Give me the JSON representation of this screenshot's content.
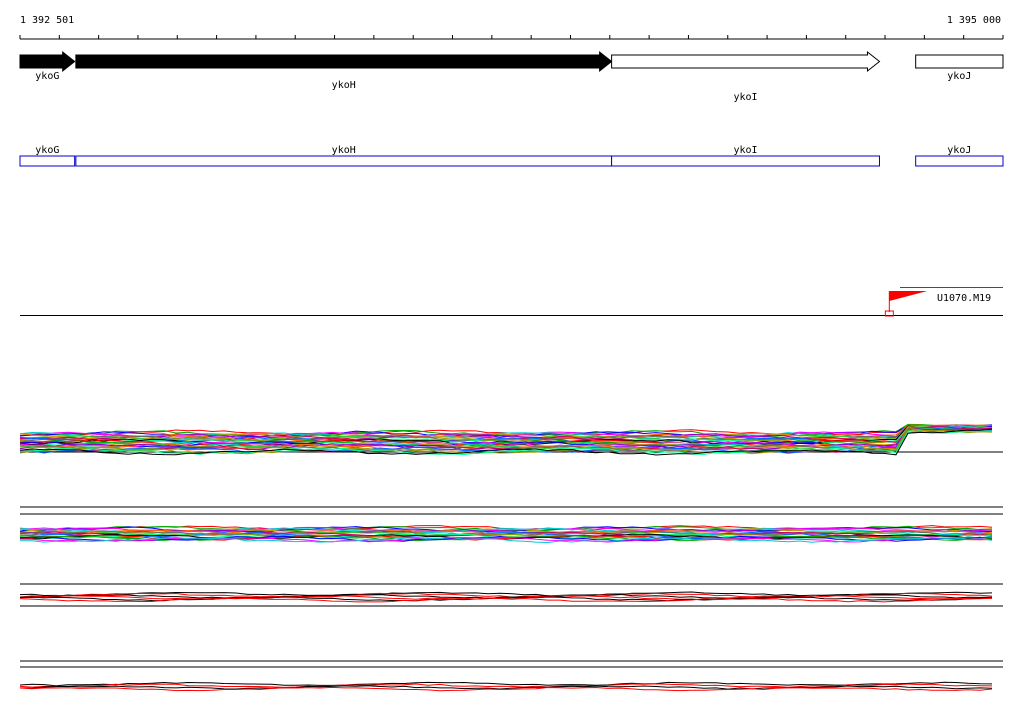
{
  "ruler": {
    "start_label": "1 392 501",
    "end_label": "1 395 000",
    "start": 1392501,
    "end": 1395000
  },
  "genes": [
    {
      "name": "ykoG",
      "strand": "+",
      "filled": true,
      "start": 1392501,
      "end": 1392640,
      "label_row": 0
    },
    {
      "name": "ykoH",
      "strand": "+",
      "filled": true,
      "start": 1392643,
      "end": 1394005,
      "label_row": 1
    },
    {
      "name": "ykoI",
      "strand": "+",
      "filled": false,
      "start": 1394005,
      "end": 1394686,
      "label_row": 2
    },
    {
      "name": "ykoJ",
      "strand": "+",
      "filled": false,
      "start": 1394778,
      "end": 1395000,
      "label_row": 0
    }
  ],
  "transcripts": [
    {
      "name": "ykoG",
      "start": 1392501,
      "end": 1392640
    },
    {
      "name": "ykoH",
      "start": 1392643,
      "end": 1394005
    },
    {
      "name": "ykoI",
      "start": 1394005,
      "end": 1394686
    },
    {
      "name": "ykoJ",
      "start": 1394778,
      "end": 1395000
    }
  ],
  "promoter": {
    "name": "U1070.M19",
    "position": 1394711,
    "color": "#ff0000"
  },
  "colors": {
    "gene_fill": "#000000",
    "transcript_stroke": "#0000cc",
    "signal_red": "#ff0000"
  }
}
